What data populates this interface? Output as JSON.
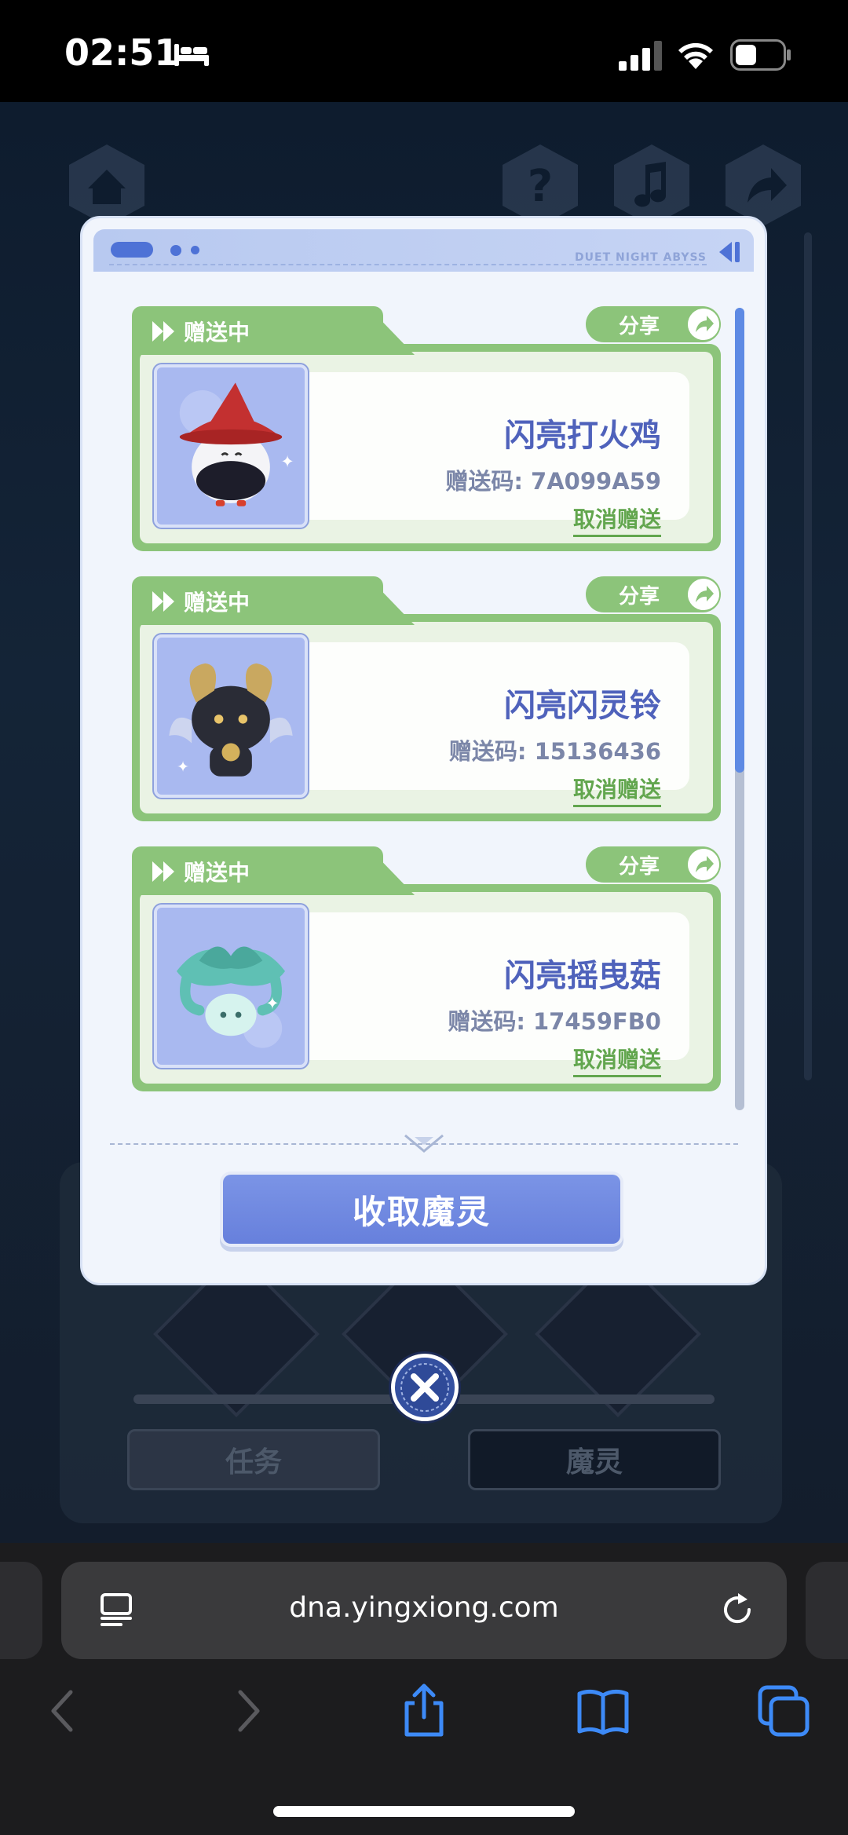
{
  "status_bar": {
    "time": "02:51"
  },
  "dialog": {
    "brand": "DUET NIGHT ABYSS",
    "gifts": [
      {
        "status": "赠送中",
        "share_label": "分享",
        "name": "闪亮打火鸡",
        "code": "赠送码: 7A099A59",
        "cancel_label": "取消赠送"
      },
      {
        "status": "赠送中",
        "share_label": "分享",
        "name": "闪亮闪灵铃",
        "code": "赠送码: 15136436",
        "cancel_label": "取消赠送"
      },
      {
        "status": "赠送中",
        "share_label": "分享",
        "name": "闪亮摇曳菇",
        "code": "赠送码: 17459FB0",
        "cancel_label": "取消赠送"
      }
    ],
    "collect_button": "收取魔灵"
  },
  "background": {
    "tabs": [
      {
        "label": "任务"
      },
      {
        "label": "魔灵"
      }
    ]
  },
  "browser": {
    "url": "dna.yingxiong.com"
  },
  "colors": {
    "accent_green": "#8cc47a",
    "accent_blue": "#6780dc",
    "name_blue": "#4f62bb"
  }
}
